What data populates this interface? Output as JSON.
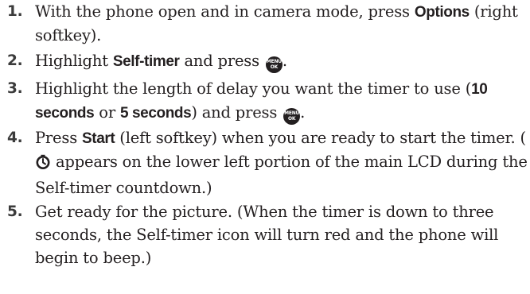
{
  "steps": [
    {
      "num": "1.",
      "pre": "With the phone open and in camera mode, press ",
      "bold": "Options",
      "post": " (right softkey)."
    },
    {
      "num": "2.",
      "pre": "Highlight ",
      "bold": "Self-timer",
      "post": " and press ",
      "end": "."
    },
    {
      "num": "3.",
      "pre": "Highlight the length of delay you want the timer to use (",
      "bold1": "10 seconds",
      "mid": " or ",
      "bold2": "5 seconds",
      "post": ") and press ",
      "end": "."
    },
    {
      "num": "4.",
      "pre": "Press ",
      "bold": "Start",
      "post": " (left softkey) when you are ready to start the timer. (",
      "post2": " appears on the lower left portion of the main LCD during the Self-timer countdown.)"
    },
    {
      "num": "5.",
      "text": "Get ready for the picture. (When the timer is down to three seconds, the Self-timer icon will turn red and the phone will begin to beep.)"
    }
  ],
  "menu_key": {
    "top": "MENU",
    "bottom": "OK",
    "icon": "menu-ok-key-icon"
  },
  "timer_icon": "self-timer-icon"
}
